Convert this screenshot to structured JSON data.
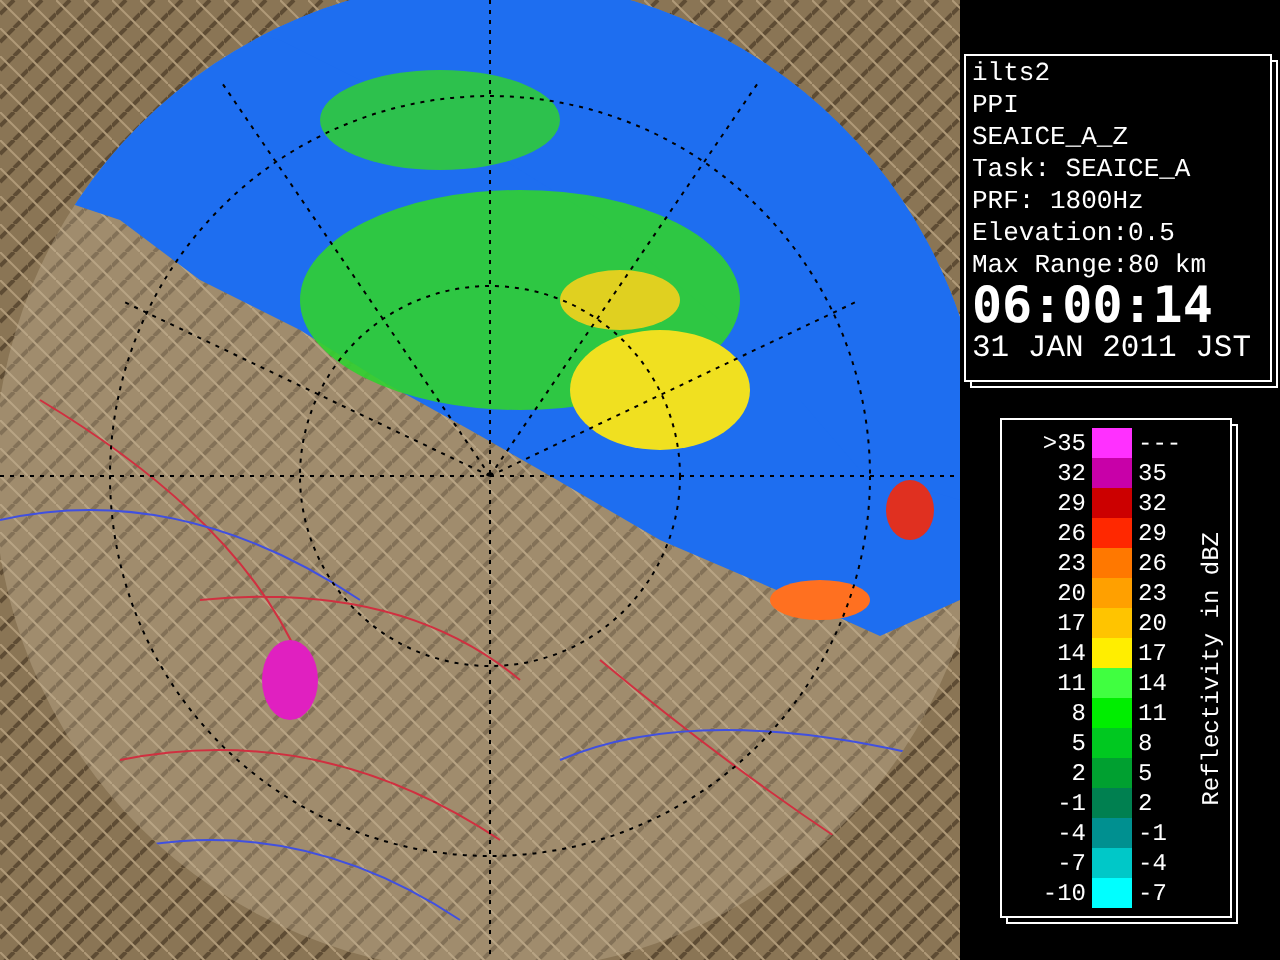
{
  "info": {
    "lines": [
      "ilts2",
      "PPI",
      "SEAICE_A_Z",
      "Task: SEAICE_A",
      "PRF: 1800Hz",
      "Elevation:0.5",
      "Max Range:80 km"
    ],
    "time": "06:00:14",
    "date": "31 JAN 2011 JST"
  },
  "legend": {
    "title": "Reflectivity in dBZ",
    "rows": [
      {
        "low": ">35",
        "high": "---",
        "color": "#ff30ff"
      },
      {
        "low": "32",
        "high": "35",
        "color": "#c800a8"
      },
      {
        "low": "29",
        "high": "32",
        "color": "#cc0000"
      },
      {
        "low": "26",
        "high": "29",
        "color": "#ff2800"
      },
      {
        "low": "23",
        "high": "26",
        "color": "#ff7800"
      },
      {
        "low": "20",
        "high": "23",
        "color": "#ffa000"
      },
      {
        "low": "17",
        "high": "20",
        "color": "#ffc400"
      },
      {
        "low": "14",
        "high": "17",
        "color": "#ffee00"
      },
      {
        "low": "11",
        "high": "14",
        "color": "#40ff40"
      },
      {
        "low": "8",
        "high": "11",
        "color": "#00ee00"
      },
      {
        "low": "5",
        "high": "8",
        "color": "#00c820"
      },
      {
        "low": "2",
        "high": "5",
        "color": "#00a030"
      },
      {
        "low": "-1",
        "high": "2",
        "color": "#008050"
      },
      {
        "low": "-4",
        "high": "-1",
        "color": "#009090"
      },
      {
        "low": "-7",
        "high": "-4",
        "color": "#00c8c8"
      },
      {
        "low": "-10",
        "high": "-7",
        "color": "#00ffff"
      }
    ]
  }
}
